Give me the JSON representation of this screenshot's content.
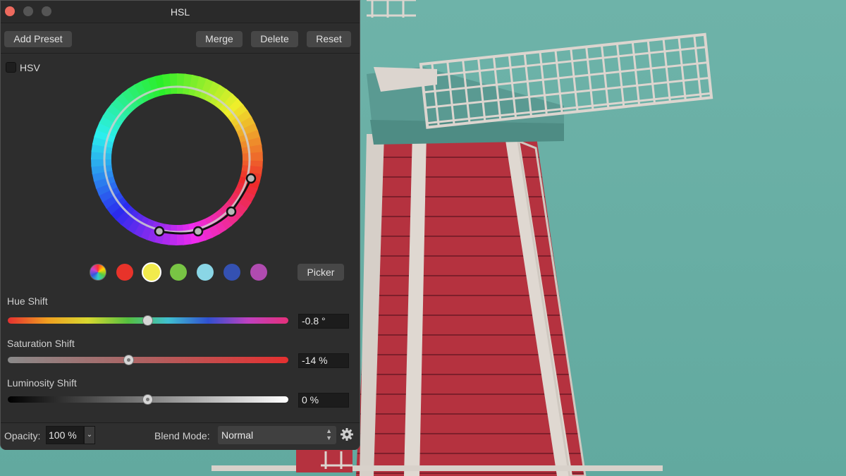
{
  "window": {
    "title": "HSL"
  },
  "toolbar": {
    "add_preset": "Add Preset",
    "merge": "Merge",
    "delete": "Delete",
    "reset": "Reset"
  },
  "hsv": {
    "label": "HSV",
    "checked": false
  },
  "swatches": [
    {
      "name": "all-colors",
      "color": "multicolor"
    },
    {
      "name": "red",
      "color": "#e8332a"
    },
    {
      "name": "yellow",
      "color": "#f1ea4c",
      "selected": true
    },
    {
      "name": "green",
      "color": "#78c444"
    },
    {
      "name": "cyan",
      "color": "#8ad6e6"
    },
    {
      "name": "blue",
      "color": "#3451b2"
    },
    {
      "name": "magenta",
      "color": "#b04bb0"
    }
  ],
  "picker_label": "Picker",
  "sliders": {
    "hue": {
      "label": "Hue Shift",
      "value": "-0.8 °"
    },
    "saturation": {
      "label": "Saturation Shift",
      "value": "-14 %"
    },
    "luminosity": {
      "label": "Luminosity Shift",
      "value": "0 %"
    }
  },
  "footer": {
    "opacity_label": "Opacity:",
    "opacity_value": "100 %",
    "blend_label": "Blend Mode:",
    "blend_value": "Normal"
  },
  "icons": {
    "window_close": "close-icon",
    "gear": "gear-icon",
    "dropdown": "chevron-down-icon"
  }
}
